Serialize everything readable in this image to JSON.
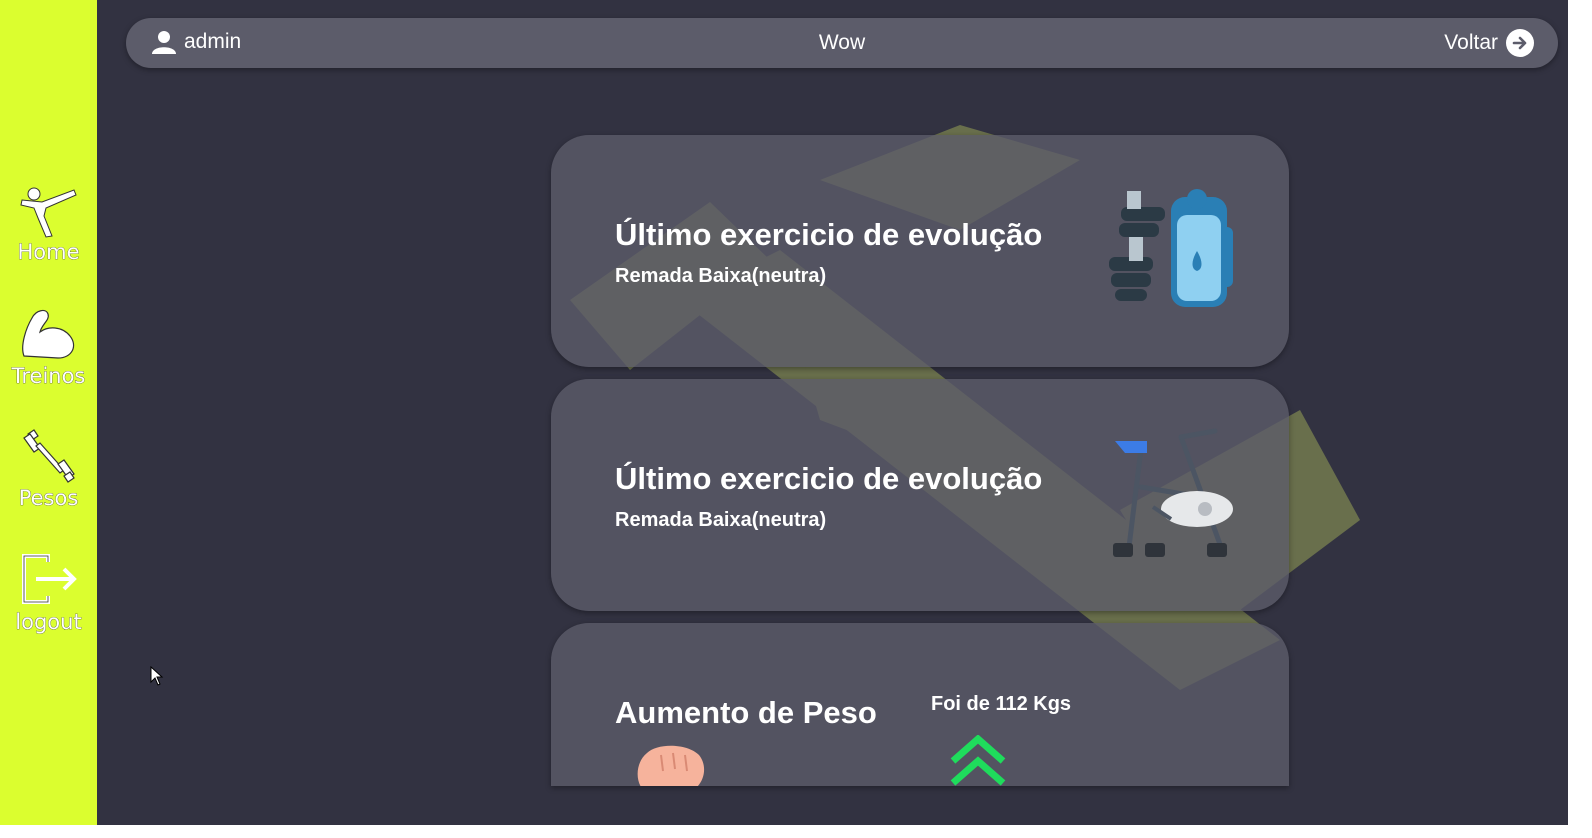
{
  "sidebar": {
    "items": [
      {
        "label": "Home",
        "icon": "karate-kick-icon"
      },
      {
        "label": "Treinos",
        "icon": "flexed-arm-icon"
      },
      {
        "label": "Pesos",
        "icon": "barbell-icon"
      },
      {
        "label": "logout",
        "icon": "logout-icon"
      }
    ],
    "color": "#dbfe2f"
  },
  "topbar": {
    "username": "admin",
    "title": "Wow",
    "back_label": "Voltar"
  },
  "cards": [
    {
      "title": "Último exercicio de evolução",
      "subtitle": "Remada Baixa(neutra)",
      "icon": "dumbbell-bottle-icon"
    },
    {
      "title": "Último exercicio de evolução",
      "subtitle": "Remada Baixa(neutra)",
      "icon": "exercise-bike-icon"
    },
    {
      "title": "Aumento de Peso",
      "subtitle": "Foi de 112 Kgs",
      "icon": "fist-icon",
      "trend_icon": "double-chevron-up-icon"
    }
  ],
  "colors": {
    "background": "#323241",
    "card": "#5c5c6a",
    "accent": "#dbfe2f",
    "trend": "#1fdc5c"
  }
}
